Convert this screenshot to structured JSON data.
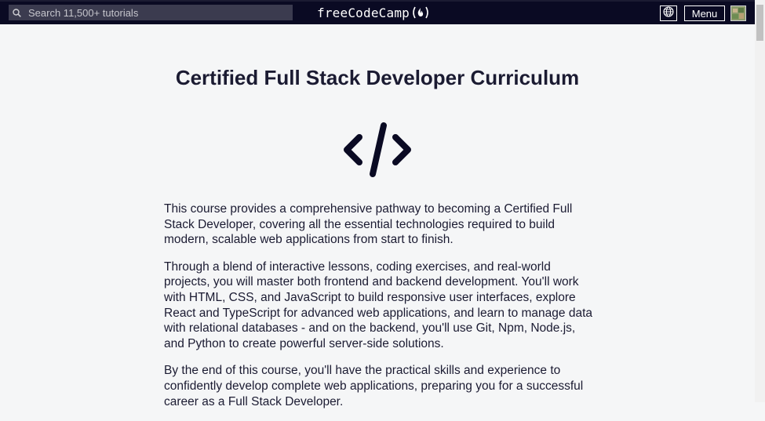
{
  "navbar": {
    "search": {
      "placeholder": "Search 11,500+ tutorials",
      "value": ""
    },
    "logo_text": "freeCodeCamp",
    "logo_icon": "flame-icon",
    "language_icon": "globe-icon",
    "menu_label": "Menu",
    "avatar": "avatar"
  },
  "main": {
    "title": "Certified Full Stack Developer Curriculum",
    "hero_icon": "code-icon",
    "paragraphs": [
      "This course provides a comprehensive pathway to becoming a Certified Full Stack Developer, covering all the essential technologies required to build modern, scalable web applications from start to finish.",
      "Through a blend of interactive lessons, coding exercises, and real-world projects, you will master both frontend and backend development. You'll work with HTML, CSS, and JavaScript to build responsive user interfaces, explore React and TypeScript for advanced web applications, and learn to manage data with relational databases - and on the backend, you'll use Git, Npm, Node.js, and Python to create powerful server-side solutions.",
      "By the end of this course, you'll have the practical skills and experience to confidently develop complete web applications, preparing you for a successful career as a Full Stack Developer."
    ]
  },
  "colors": {
    "navbar_bg": "#0a0a23",
    "search_bg": "#3b3b4f",
    "page_bg": "#f5f6f7",
    "text": "#1b1b32"
  }
}
